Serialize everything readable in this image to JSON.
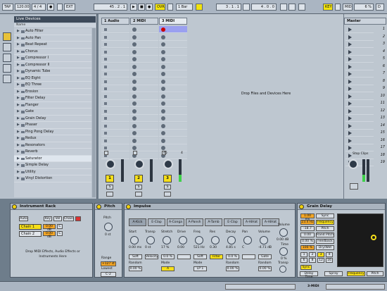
{
  "transport": {
    "tap": "TAP",
    "tempo": "120.00",
    "sig": "4 / 4",
    "metro": "●",
    "ext": "EXT",
    "position": "45 . 2 . 1",
    "ovr": "OVR",
    "quant": "1 Bar",
    "loop_start": "3 . 1 . 1",
    "loop_len": "4 . 0 . 0",
    "key": "KEY",
    "midi": "MIDI",
    "cpu": "6 %",
    "d": "D"
  },
  "browser": {
    "title": "Live Devices",
    "header": "Name",
    "items": [
      "Auto Filter",
      "Auto Pan",
      "Beat Repeat",
      "Chorus",
      "Compressor I",
      "Compressor II",
      "Dynamic Tube",
      "EQ Eight",
      "EQ Three",
      "Erosion",
      "Filter Delay",
      "Flanger",
      "Gate",
      "Grain Delay",
      "Phaser",
      "Ping Pong Delay",
      "Redux",
      "Resonators",
      "Reverb",
      "Saturator",
      "Simple Delay",
      "Utility",
      "Vinyl Distortion"
    ],
    "selected_index": 19
  },
  "session": {
    "tracks": [
      {
        "name": "1 Audio",
        "num": "1"
      },
      {
        "name": "2 MIDI",
        "num": "2"
      },
      {
        "name": "3 MIDI",
        "num": "3"
      }
    ],
    "drop_text": "Drop Files and Devices Here",
    "sends_value": "45",
    "sends_value2": "4",
    "solo": "S"
  },
  "master": {
    "title": "Master",
    "scenes": [
      "1",
      "2",
      "3",
      "4",
      "5",
      "6",
      "7",
      "8",
      "9",
      "10",
      "11",
      "12",
      "13",
      "14",
      "15",
      "16",
      "17",
      "18",
      "19"
    ],
    "stop_clips": "Stop Clips"
  },
  "devices": {
    "instrument_rack": {
      "title": "Instrument Rack",
      "auto": "Auto",
      "key": "Key",
      "vel": "Vel",
      "chain": "Chain",
      "chains": [
        {
          "name": "Chain 1",
          "db": "0.00 dB",
          "pan": "C"
        },
        {
          "name": "Chain 2",
          "db": "0.00 dB",
          "pan": "C"
        }
      ],
      "drop_text": "Drop MIDI Effects, Audio Effects or Instruments Here"
    },
    "pitch": {
      "title": "Pitch",
      "label": "Pitch",
      "value": "0 st",
      "range_label": "Range",
      "range_val": "+127 st",
      "lowest_label": "Lowest",
      "lowest_val": "C-2"
    },
    "impulse": {
      "title": "Impulse",
      "pads": [
        "A-Kick",
        "E-Clap",
        "A-Conga",
        "A-Pansh",
        "A-Tamb",
        "E-Clap",
        "A-HiHat",
        "A-HiHat"
      ],
      "labels": [
        "Start",
        "Transp",
        "Stretch",
        "Drive",
        "Freq",
        "Res",
        "Decay",
        "Pan",
        "Volume"
      ],
      "values": [
        "0.00 ms",
        "0 st",
        "17 %",
        "0.00",
        "521 Hz",
        "0.30",
        "4.85 s",
        "C",
        "-4.71 dB"
      ],
      "row2": [
        "Soft",
        "Velocity",
        "0.0 %",
        "",
        "Soft",
        "Filter",
        "0.0 %",
        "",
        "Gate"
      ],
      "vol_label": "Volume",
      "vol_val": "0.00 dB",
      "time_label": "Time",
      "time_val": "0 %",
      "transp_label": "Transp",
      "transp_val": "0 st",
      "mode_labels": [
        "Random",
        "Mode",
        "Mode",
        "Random",
        "Random"
      ],
      "mode_vals": [
        "0.00 %",
        "A",
        "LP 1",
        "0.00 %",
        "0.00 %"
      ],
      "vel": [
        "0.00 %",
        "0.00 %",
        "70.0 %"
      ]
    },
    "grain_delay": {
      "title": "Grain Delay",
      "time_val": "1.00 ms",
      "sync": "Sync",
      "freq_val": "23.4 Hz",
      "frequency": "Frequency",
      "pitch_val": "-18.7",
      "pitch": "Pitch",
      "rand_val": "0.00",
      "rand_pitch": "Rand Pitch",
      "fb_val": "0.00 %",
      "feedback": "Feedback",
      "dw_val": "100 %",
      "dry_wet": "Dry/Wet",
      "beats": [
        "1",
        "2",
        "3",
        "4",
        "6",
        "8",
        "12",
        "16"
      ],
      "delay_time": "Delay Time",
      "spray": "Spray",
      "frequency2": "Frequency",
      "pitch2": "Pitch"
    }
  },
  "status": {
    "track": "3-MIDI"
  },
  "colors": {
    "accent": "#f6df1a",
    "orange": "#f3a626",
    "dark": "#3d4a5a"
  }
}
